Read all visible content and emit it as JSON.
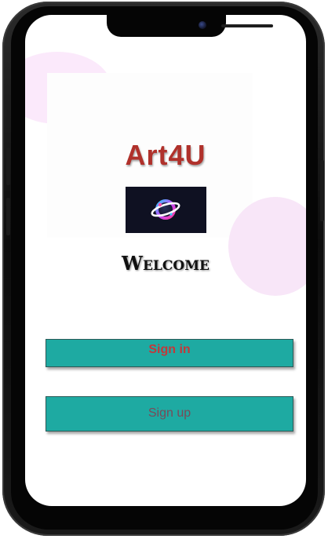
{
  "app": {
    "title": "Art4U",
    "logo_icon": "orbit-planet-icon",
    "welcome_text": "Welcome"
  },
  "buttons": {
    "signin_label": "Sign in",
    "signup_label": "Sign up"
  },
  "colors": {
    "title": "#b0312b",
    "button_bg": "#1eaaa2",
    "signin_text": "#c2383a",
    "signup_text": "#7a4a58",
    "blob": "#fbe9fb",
    "logo_bg": "#0f1122"
  }
}
